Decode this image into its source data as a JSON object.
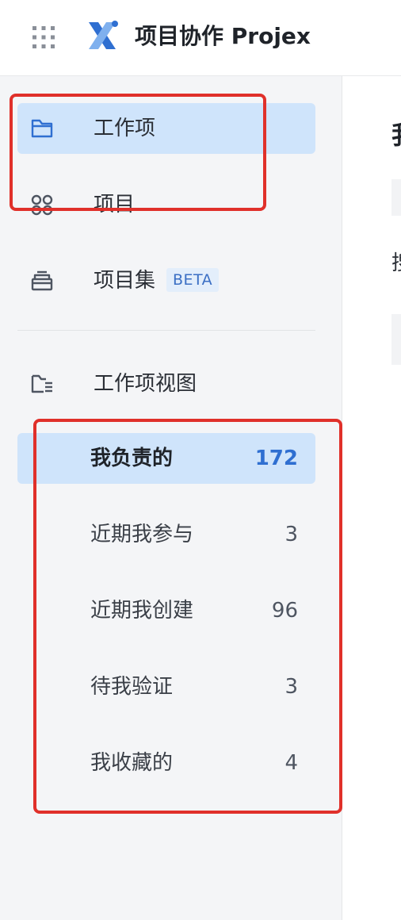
{
  "header": {
    "title": "项目协作 Projex",
    "apps_icon": "grid-dots-icon",
    "logo_icon": "projex-logo-icon"
  },
  "sidebar": {
    "nav": [
      {
        "label": "工作项",
        "icon": "folder-icon",
        "active": true
      },
      {
        "label": "项目",
        "icon": "project-circles-icon",
        "active": false
      },
      {
        "label": "项目集",
        "icon": "stack-icon",
        "badge": "BETA",
        "active": false
      },
      {
        "label": "工作项视图",
        "icon": "folder-list-icon",
        "active": false
      }
    ],
    "views": [
      {
        "label": "我负责的",
        "count": "172",
        "active": true
      },
      {
        "label": "近期我参与",
        "count": "3",
        "active": false
      },
      {
        "label": "近期我创建",
        "count": "96",
        "active": false
      },
      {
        "label": "待我验证",
        "count": "3",
        "active": false
      },
      {
        "label": "我收藏的",
        "count": "4",
        "active": false
      }
    ]
  },
  "main": {
    "heading": "我",
    "label": "搜"
  },
  "colors": {
    "accent": "#2f6fd1",
    "active_bg": "#cfe4fb",
    "annotation": "#e0302a"
  }
}
